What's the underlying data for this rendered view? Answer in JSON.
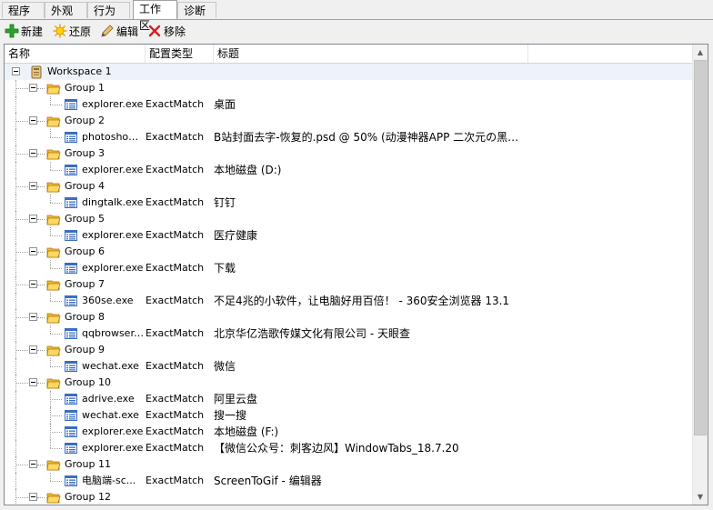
{
  "tabs": [
    {
      "label": "程序",
      "active": false
    },
    {
      "label": "外观",
      "active": false
    },
    {
      "label": "行为",
      "active": false
    },
    {
      "label": "工作区",
      "active": true
    },
    {
      "label": "诊断",
      "active": false
    }
  ],
  "toolbar": {
    "new_label": "新建",
    "restore_label": "还原",
    "edit_label": "编辑",
    "remove_label": "移除"
  },
  "columns": {
    "name": "名称",
    "type": "配置类型",
    "title": "标题"
  },
  "workspace": {
    "label": "Workspace 1"
  },
  "groups": [
    {
      "label": "Group 1",
      "items": [
        {
          "exe": "explorer.exe",
          "type": "ExactMatch",
          "title": "桌面"
        }
      ]
    },
    {
      "label": "Group 2",
      "items": [
        {
          "exe": "photoshop....",
          "type": "ExactMatch",
          "title": "B站封面去字-恢复的.psd @ 50% (动漫神器APP 二次元の黑科..."
        }
      ]
    },
    {
      "label": "Group 3",
      "items": [
        {
          "exe": "explorer.exe",
          "type": "ExactMatch",
          "title": "本地磁盘 (D:)"
        }
      ]
    },
    {
      "label": "Group 4",
      "items": [
        {
          "exe": "dingtalk.exe",
          "type": "ExactMatch",
          "title": "钉钉"
        }
      ]
    },
    {
      "label": "Group 5",
      "items": [
        {
          "exe": "explorer.exe",
          "type": "ExactMatch",
          "title": "医疗健康"
        }
      ]
    },
    {
      "label": "Group 6",
      "items": [
        {
          "exe": "explorer.exe",
          "type": "ExactMatch",
          "title": "下载"
        }
      ]
    },
    {
      "label": "Group 7",
      "items": [
        {
          "exe": "360se.exe",
          "type": "ExactMatch",
          "title": "不足4兆的小软件，让电脑好用百倍！ - 360安全浏览器 13.1"
        }
      ]
    },
    {
      "label": "Group 8",
      "items": [
        {
          "exe": "qqbrowser....",
          "type": "ExactMatch",
          "title": "北京华亿浩歌传媒文化有限公司 - 天眼查"
        }
      ]
    },
    {
      "label": "Group 9",
      "items": [
        {
          "exe": "wechat.exe",
          "type": "ExactMatch",
          "title": "微信"
        }
      ]
    },
    {
      "label": "Group 10",
      "items": [
        {
          "exe": "adrive.exe",
          "type": "ExactMatch",
          "title": "阿里云盘"
        },
        {
          "exe": "wechat.exe",
          "type": "ExactMatch",
          "title": "搜一搜"
        },
        {
          "exe": "explorer.exe",
          "type": "ExactMatch",
          "title": "本地磁盘 (F:)"
        },
        {
          "exe": "explorer.exe",
          "type": "ExactMatch",
          "title": "【微信公众号：刺客边风】WindowTabs_18.7.20"
        }
      ]
    },
    {
      "label": "Group 11",
      "items": [
        {
          "exe": "电脑端-sc...",
          "type": "ExactMatch",
          "title": "ScreenToGif - 编辑器"
        }
      ]
    },
    {
      "label": "Group 12",
      "items": []
    }
  ],
  "colors": {
    "folder": "#f5c542",
    "selection": "#eef3fa",
    "plus": "#2aa52a",
    "remove": "#d42020"
  },
  "icons": {
    "new": "green-plus-icon",
    "restore": "sun-icon",
    "edit": "pencil-icon",
    "remove": "red-x-icon",
    "folder": "folder-open-icon",
    "window": "window-icon",
    "workspace": "workspace-icon"
  }
}
